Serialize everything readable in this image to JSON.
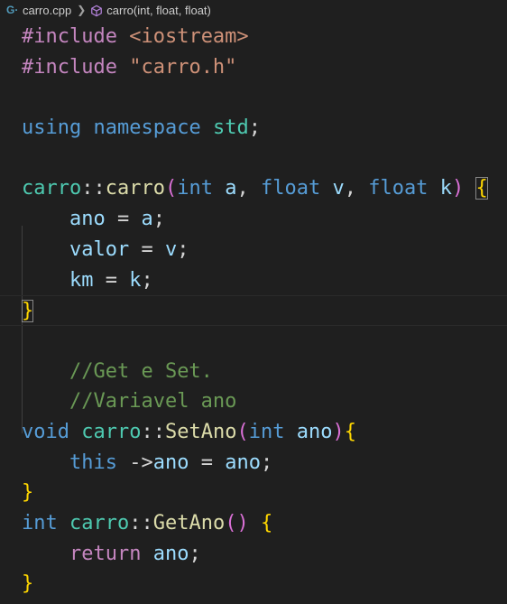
{
  "breadcrumb": {
    "file": "carro.cpp",
    "symbol": "carro(int, float, float)"
  },
  "colors": {
    "background": "#1f1f1f",
    "preprocessor": "#c586c0",
    "string": "#ce9178",
    "keyword": "#569cd6",
    "type": "#4ec9b0",
    "function": "#dcdcaa",
    "variable": "#9cdcfe",
    "comment": "#6a9955",
    "bracket_gold": "#ffd700",
    "bracket_orchid": "#da70d6"
  },
  "icons": {
    "file_icon": "cpp-file-icon",
    "symbol_icon": "method-cube-icon",
    "separator_icon": "chevron-right-icon"
  },
  "code": {
    "l1": {
      "directive": "#include",
      "header": "<iostream>"
    },
    "l2": {
      "directive": "#include",
      "header": "\"carro.h\""
    },
    "l4": {
      "kw1": "using",
      "kw2": "namespace",
      "ns": "std",
      "semi": ";"
    },
    "l6": {
      "cls": "carro",
      "scope": "::",
      "fn": "carro",
      "open": "(",
      "t1": "int",
      "p1": "a",
      "c1": ",",
      "t2": "float",
      "p2": "v",
      "c2": ",",
      "t3": "float",
      "p3": "k",
      "close": ")",
      "brace": "{"
    },
    "l7": {
      "lhs": "ano",
      "op": "=",
      "rhs": "a",
      "semi": ";"
    },
    "l8": {
      "lhs": "valor",
      "op": "=",
      "rhs": "v",
      "semi": ";"
    },
    "l9": {
      "lhs": "km",
      "op": "=",
      "rhs": "k",
      "semi": ";"
    },
    "l10": {
      "brace": "}"
    },
    "l12": {
      "comment": "//Get e Set."
    },
    "l13": {
      "comment": "//Variavel ano"
    },
    "l14": {
      "ret": "void",
      "cls": "carro",
      "scope": "::",
      "fn": "SetAno",
      "open": "(",
      "t1": "int",
      "p1": "ano",
      "close": ")",
      "brace": "{"
    },
    "l15": {
      "kw": "this",
      "arrow": "->",
      "member": "ano",
      "op": "=",
      "rhs": "ano",
      "semi": ";"
    },
    "l16": {
      "brace": "}"
    },
    "l17": {
      "ret": "int",
      "cls": "carro",
      "scope": "::",
      "fn": "GetAno",
      "open": "(",
      "close": ")",
      "brace": "{"
    },
    "l18": {
      "kw": "return",
      "val": "ano",
      "semi": ";"
    },
    "l19": {
      "brace": "}"
    }
  }
}
